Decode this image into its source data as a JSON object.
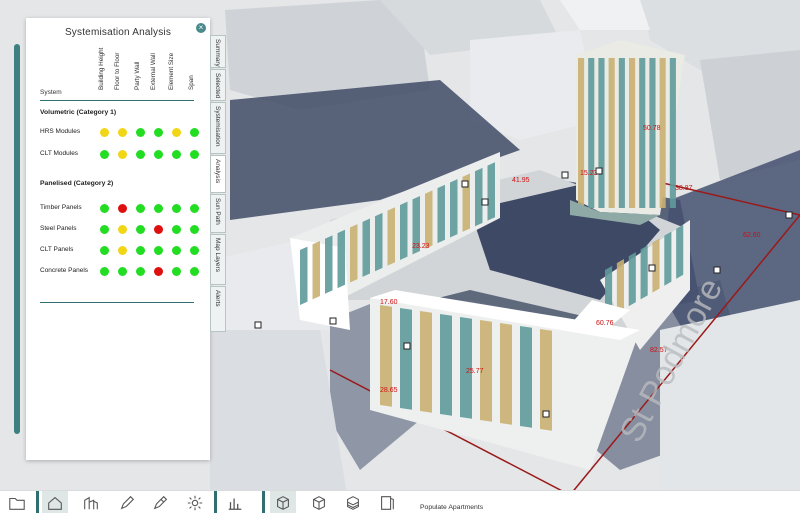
{
  "panel": {
    "title": "Systemisation Analysis",
    "close_glyph": "×",
    "system_label": "System",
    "columns": [
      "Building Height",
      "Floor to Floor",
      "Party Wall",
      "External Wall",
      "Element Size",
      "Span"
    ],
    "groups": [
      {
        "title": "Volumetric (Category 1)",
        "rows": [
          {
            "label": "HRS Modules",
            "status": [
              "amber",
              "amber",
              "green",
              "green",
              "amber",
              "green"
            ]
          },
          {
            "label": "CLT Modules",
            "status": [
              "green",
              "amber",
              "green",
              "green",
              "green",
              "green"
            ]
          }
        ]
      },
      {
        "title": "Panelised (Category 2)",
        "rows": [
          {
            "label": "Timber Panels",
            "status": [
              "green",
              "red",
              "green",
              "green",
              "green",
              "green"
            ]
          },
          {
            "label": "Steel Panels",
            "status": [
              "green",
              "amber",
              "green",
              "red",
              "green",
              "green"
            ]
          },
          {
            "label": "CLT Panels",
            "status": [
              "green",
              "amber",
              "green",
              "green",
              "green",
              "green"
            ]
          },
          {
            "label": "Concrete Panels",
            "status": [
              "green",
              "green",
              "green",
              "red",
              "green",
              "green"
            ]
          }
        ]
      }
    ]
  },
  "tabs": [
    "Summary",
    "Selected",
    "Systemisation",
    "Analysis",
    "Sun Path",
    "Map Layers",
    "Alerts"
  ],
  "active_tab": "Analysis",
  "scene_labels": [
    "41.95",
    "50.78",
    "15.23",
    "38.87",
    "62.60",
    "23.23",
    "17.60",
    "60.76",
    "82.57",
    "25.77",
    "28.65"
  ],
  "toolbar": {
    "populate_label": "Populate Apartments",
    "icons": [
      "folder-icon",
      "house-icon",
      "buildings-icon",
      "pencil-icon",
      "pencil-edit-icon",
      "gear-icon",
      "bar-chart-icon",
      "cube-outline-icon",
      "cube-icon",
      "stacked-cube-icon",
      "panel-icon"
    ]
  },
  "colors": {
    "accent": "#3e7f82",
    "status_green": "#22dd22",
    "status_amber": "#f1d617",
    "status_red": "#e00f0f",
    "site_line": "#9a1a1a",
    "facade_teal": "#5f9a9a",
    "facade_gold": "#c9b072"
  }
}
